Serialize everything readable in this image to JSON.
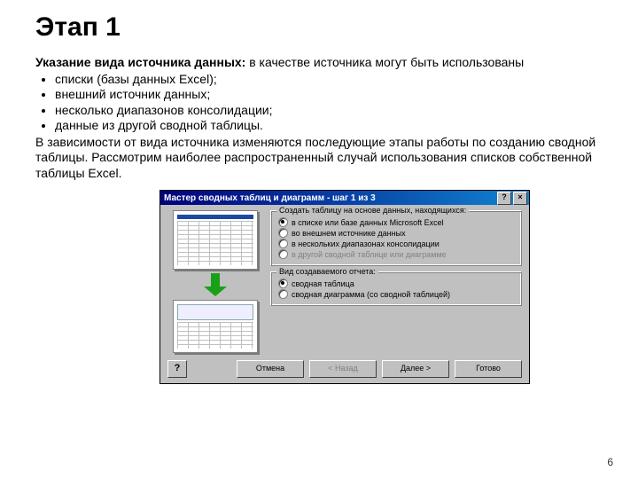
{
  "slide": {
    "title": "Этап 1",
    "intro_bold": "Указание вида источника данных:",
    "intro_rest": " в качестве источника могут быть использованы",
    "bullets": [
      "списки (базы данных Excel);",
      "внешний источник данных;",
      "несколько диапазонов консолидации;",
      "данные из другой сводной таблицы."
    ],
    "tail": "В зависимости от вида источника изменяются последующие этапы работы по созданию сводной таблицы. Рассмотрим наиболее распространенный случай использования списков собственной таблицы Excel."
  },
  "wizard": {
    "title": "Мастер сводных таблиц и диаграмм - шаг 1 из 3",
    "help_icon": "?",
    "close_icon": "×",
    "group1_label": "Создать таблицу на основе данных, находящихся:",
    "radios1": [
      {
        "label": "в списке или базе данных Microsoft Excel",
        "selected": true,
        "disabled": false
      },
      {
        "label": "во внешнем источнике данных",
        "selected": false,
        "disabled": false
      },
      {
        "label": "в нескольких диапазонах консолидации",
        "selected": false,
        "disabled": false
      },
      {
        "label": "в другой сводной таблице или диаграмме",
        "selected": false,
        "disabled": true
      }
    ],
    "group2_label": "Вид создаваемого отчета:",
    "radios2": [
      {
        "label": "сводная таблица",
        "selected": true,
        "disabled": false
      },
      {
        "label": "сводная диаграмма (со сводной таблицей)",
        "selected": false,
        "disabled": false
      }
    ],
    "buttons": {
      "cancel": "Отмена",
      "back": "< Назад",
      "next": "Далее >",
      "finish": "Готово"
    },
    "help_btn": "?"
  },
  "page_number": "6"
}
